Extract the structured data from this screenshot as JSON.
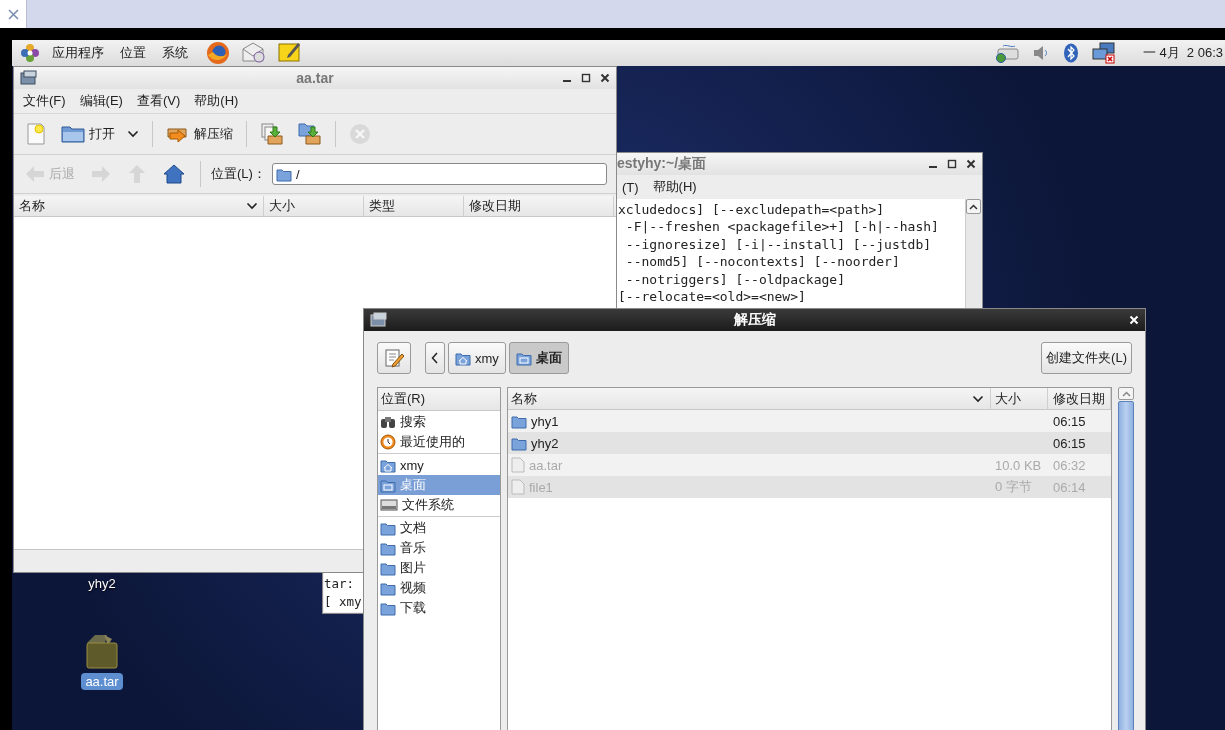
{
  "top_panel": {
    "menus": [
      "应用程序",
      "位置",
      "系统"
    ],
    "clock": "一 4月  2 06:3"
  },
  "archive_window": {
    "title": "aa.tar",
    "menu": [
      "文件(F)",
      "编辑(E)",
      "查看(V)",
      "帮助(H)"
    ],
    "toolbar": [
      {
        "kind": "new",
        "disabled": false
      },
      {
        "kind": "open",
        "label": "打开",
        "disabled": false
      },
      {
        "kind": "extract",
        "label": "解压缩",
        "disabled": false
      },
      {
        "kind": "add-files",
        "disabled": false
      },
      {
        "kind": "add-folder",
        "disabled": false
      },
      {
        "kind": "stop",
        "disabled": true
      }
    ],
    "nav": [
      {
        "kind": "back",
        "label": "后退",
        "disabled": true
      },
      {
        "kind": "forward",
        "disabled": true
      },
      {
        "kind": "up",
        "disabled": true
      },
      {
        "kind": "home",
        "disabled": false
      }
    ],
    "location_label": "位置(L)：",
    "location": "/",
    "columns": [
      "名称",
      "大小",
      "类型",
      "修改日期"
    ]
  },
  "terminal": {
    "title": "estyhy:~/桌面",
    "menu": [
      "(T)",
      "帮助(H)"
    ],
    "lines": [
      "xcludedocs] [--excludepath=<path>]",
      " -F|--freshen <packagefile>+] [-h|--hash]",
      " --ignoresize] [-i|--install] [--justdb]",
      " --nomd5] [--nocontexts] [--noorder]",
      " --notriggers] [--oldpackage]",
      "[--relocate=<old>=<new>]"
    ],
    "bottom_lines": [
      "tar:",
      "[ xmy"
    ]
  },
  "dialog": {
    "title": "解压缩",
    "path": [
      {
        "label": "xmy",
        "kind": "home",
        "selected": false
      },
      {
        "label": "桌面",
        "kind": "desktop",
        "selected": true
      }
    ],
    "create_folder": "创建文件夹(L)",
    "places_header": "位置(R)",
    "place_groups": [
      [
        {
          "label": "搜索",
          "kind": "search",
          "selected": false
        },
        {
          "label": "最近使用的",
          "kind": "recent",
          "selected": false
        }
      ],
      [
        {
          "label": "xmy",
          "kind": "home",
          "selected": false
        },
        {
          "label": "桌面",
          "kind": "desktop",
          "selected": true
        },
        {
          "label": "文件系统",
          "kind": "drive",
          "selected": false
        }
      ],
      [
        {
          "label": "文档",
          "kind": "folder",
          "selected": false
        },
        {
          "label": "音乐",
          "kind": "folder",
          "selected": false
        },
        {
          "label": "图片",
          "kind": "folder",
          "selected": false
        },
        {
          "label": "视频",
          "kind": "folder",
          "selected": false
        },
        {
          "label": "下载",
          "kind": "folder",
          "selected": false
        }
      ]
    ],
    "columns": [
      "名称",
      "大小",
      "修改日期"
    ],
    "files": [
      {
        "name": "yhy1",
        "kind": "folder",
        "modified": "06:15",
        "disabled": false
      },
      {
        "name": "yhy2",
        "kind": "folder",
        "modified": "06:15",
        "disabled": false
      },
      {
        "name": "aa.tar",
        "kind": "file",
        "size": "10.0 KB",
        "modified": "06:32",
        "disabled": true
      },
      {
        "name": "file1",
        "kind": "file",
        "size": "0 字节",
        "modified": "06:14",
        "disabled": true
      }
    ]
  },
  "desktop_icons": [
    {
      "label": "yhy2",
      "selected": false
    },
    {
      "label": "aa.tar",
      "kind": "archive",
      "selected": true
    }
  ]
}
